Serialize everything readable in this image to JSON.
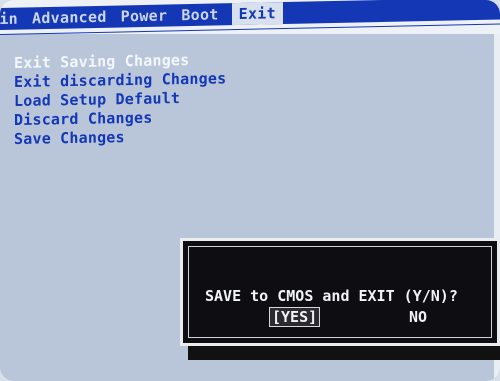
{
  "menubar": {
    "tabs": [
      {
        "label": "ain"
      },
      {
        "label": "Advanced"
      },
      {
        "label": "Power"
      },
      {
        "label": "Boot"
      },
      {
        "label": "Exit"
      }
    ]
  },
  "exit_menu": {
    "items": [
      {
        "label": "Exit Saving Changes"
      },
      {
        "label": "Exit discarding Changes"
      },
      {
        "label": "Load Setup Default"
      },
      {
        "label": "Discard Changes"
      },
      {
        "label": "Save Changes"
      }
    ]
  },
  "dialog": {
    "prompt": "SAVE to CMOS and EXIT (Y/N)?",
    "yes_label": "[YES]",
    "no_label": "NO"
  },
  "colors": {
    "menubar_bg": "#1437b5",
    "panel_bg": "#b9c6da",
    "dialog_bg": "#0d0d12"
  }
}
